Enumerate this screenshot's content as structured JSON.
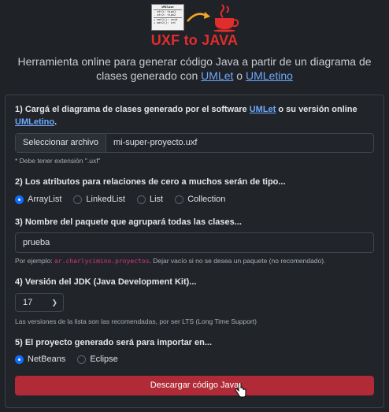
{
  "logo": {
    "uml_class_name": "UMClase",
    "uml_attrs": [
      "- atr1: tipo1",
      "- atr2: tipo2"
    ],
    "uml_methods": [
      "+ met1(): void",
      "+ met2(): int"
    ]
  },
  "header": {
    "title": "UXF to JAVA",
    "subtitle_part1": "Herramienta online para generar código Java a partir de un diagrama de clases generado con ",
    "subtitle_link1": "UMLet",
    "subtitle_middle": " o ",
    "subtitle_link2": "UMLetino"
  },
  "step1": {
    "label_part1": "1) Cargá el diagrama de clases generado por el software ",
    "label_link1": "UMLet",
    "label_part2": " o su versión online ",
    "label_link2": "UMLetino",
    "label_end": ".",
    "file_button": "Seleccionar archivo",
    "file_name": "mi-super-proyecto.uxf",
    "hint": "* Debe tener extensión \".uxf\""
  },
  "step2": {
    "label": "2) Los atributos para relaciones de cero a muchos serán de tipo...",
    "options": [
      "ArrayList",
      "LinkedList",
      "List",
      "Collection"
    ],
    "selected": "ArrayList"
  },
  "step3": {
    "label": "3) Nombre del paquete que agrupará todas las clases...",
    "value": "prueba",
    "hint_prefix": "Por ejemplo: ",
    "hint_code": "ar.charlycimino.proyectos",
    "hint_suffix": ". Dejar vacío si no se desea un paquete (no recomendado)."
  },
  "step4": {
    "label": "4) Versión del JDK (Java Development Kit)...",
    "selected": "17",
    "hint": "Las versiones de la lista son las recomendadas, por ser LTS (Long Time Support)"
  },
  "step5": {
    "label": "5) El proyecto generado será para importar en...",
    "options": [
      "NetBeans",
      "Eclipse"
    ],
    "selected": "NetBeans"
  },
  "submit_label": "Descargar código Java",
  "colors": {
    "background": "#1f2227",
    "accent_red": "#e02d2d",
    "link": "#6ea8fe",
    "primary": "#0d6efd",
    "button": "#b02a37"
  }
}
